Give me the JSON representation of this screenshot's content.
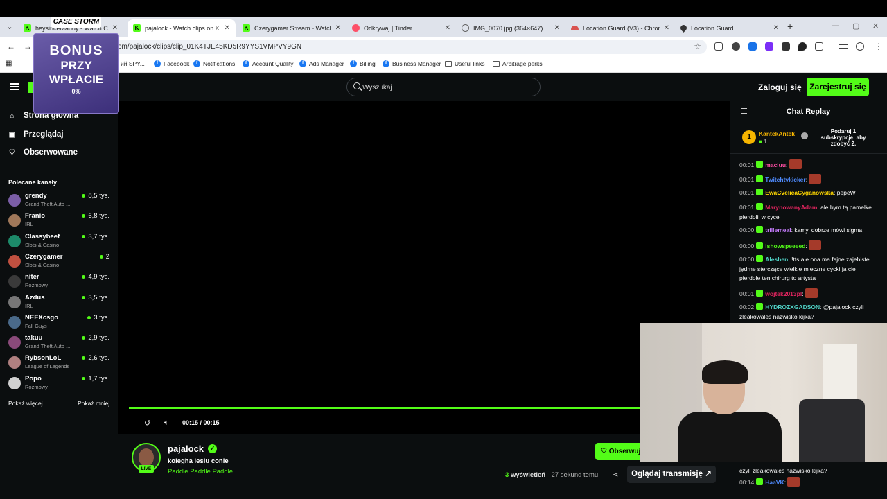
{
  "browser": {
    "tabs": [
      {
        "title": "heysinceMaddy - Watch Clips",
        "color": "#53fc18",
        "active": false
      },
      {
        "title": "pajalock - Watch clips on Kick",
        "color": "#53fc18",
        "active": true
      },
      {
        "title": "Czerygamer Stream - Watch Li",
        "color": "#53fc18",
        "active": false
      },
      {
        "title": "Odkrywaj | Tinder",
        "color": "#fd5068",
        "active": false
      },
      {
        "title": "IMG_0070.jpg (364×647)",
        "color": "#666666",
        "active": false
      },
      {
        "title": "Location Guard (V3) - Chrome",
        "color": "#d9534f",
        "active": false
      },
      {
        "title": "Location Guard",
        "color": "#333333",
        "active": false
      }
    ],
    "url": "om/pajalock/clips/clip_01K4TJE45KD5R9YYS1VMPVY9GN",
    "bookmarks": [
      {
        "label": "ий SPY...",
        "icon": "folder"
      },
      {
        "label": "Facebook",
        "icon": "facebook"
      },
      {
        "label": "Notifications",
        "icon": "facebook"
      },
      {
        "label": "Account Quality",
        "icon": "facebook"
      },
      {
        "label": "Ads Manager",
        "icon": "facebook"
      },
      {
        "label": "Billing",
        "icon": "facebook"
      },
      {
        "label": "Business Manager",
        "icon": "facebook"
      },
      {
        "label": "Useful links",
        "icon": "folder"
      },
      {
        "label": "Arbitrage perks",
        "icon": "folder"
      }
    ]
  },
  "header": {
    "search_placeholder": "Wyszukaj",
    "login": "Zaloguj się",
    "register": "Zarejestruj się",
    "accent": "#53fc18"
  },
  "sidebar": {
    "nav": [
      {
        "label": "Strona główna",
        "icon": "home-icon"
      },
      {
        "label": "Przeglądaj",
        "icon": "browse-icon"
      },
      {
        "label": "Obserwowane",
        "icon": "heart-icon"
      }
    ],
    "section_title": "Polecane kanały",
    "channels": [
      {
        "name": "grendy",
        "category": "Grand Theft Auto ...",
        "viewers": "8,5 tys.",
        "color": "#7b5ea7"
      },
      {
        "name": "Franio",
        "category": "IRL",
        "viewers": "6,8 tys.",
        "color": "#a0785a"
      },
      {
        "name": "Classybeef",
        "category": "Slots & Casino",
        "viewers": "3,7 tys.",
        "color": "#1d8a6a"
      },
      {
        "name": "Czerygamer",
        "category": "Slots & Casino",
        "viewers": "2",
        "color": "#c05040"
      },
      {
        "name": "niter",
        "category": "Rozmowy",
        "viewers": "4,9 tys.",
        "color": "#3a3a3a"
      },
      {
        "name": "Azdus",
        "category": "IRL",
        "viewers": "3,5 tys.",
        "color": "#777777"
      },
      {
        "name": "NEEXcsgo",
        "category": "Fall Guys",
        "viewers": "3 tys.",
        "color": "#4a6a8a"
      },
      {
        "name": "takuu",
        "category": "Grand Theft Auto ...",
        "viewers": "2,9 tys.",
        "color": "#8a4a7a"
      },
      {
        "name": "RybsonLoL",
        "category": "League of Legends",
        "viewers": "2,6 tys.",
        "color": "#b08080"
      },
      {
        "name": "Popo",
        "category": "Rozmowy",
        "viewers": "1,7 tys.",
        "color": "#d0d0d0"
      }
    ],
    "show_more": "Pokaż więcej",
    "show_less": "Pokaż mniej"
  },
  "player": {
    "time": "00:15 / 00:15",
    "progress": 1.0
  },
  "stream": {
    "channel": "pajalock",
    "title": "kolegha lesiu conie",
    "category": "Paddle Paddle Paddle",
    "live": "LIVE",
    "follow": "Obserwuj",
    "views_count": "3",
    "views_label": "wyświetleń",
    "ago": "· 27 sekund temu",
    "watch": "Oglądaj transmisję"
  },
  "chat": {
    "title": "Chat Replay",
    "gift_user": "KantekAntek",
    "gift_count": "1",
    "gift_text": "Podaruj 1 subskrypcję, aby zdobyć 2.",
    "messages": [
      {
        "ts": "00:01",
        "user": "maciuu",
        "color": "#ff4fa3",
        "text": ""
      },
      {
        "ts": "00:01",
        "user": "Twitchtvkicker",
        "color": "#4f8bff",
        "text": ""
      },
      {
        "ts": "00:01",
        "user": "EwaCvelicaCyganowska",
        "color": "#ffd700",
        "text": "pepeW"
      },
      {
        "ts": "00:01",
        "user": "MarynowanyAdam",
        "color": "#e0245e",
        "text": "ale bym tą pamelke pierdolil w cyce"
      },
      {
        "ts": "00:00",
        "user": "trillemeal",
        "color": "#c77dff",
        "text": "kamyl dobrze mówi sigma"
      },
      {
        "ts": "00:00",
        "user": "ishowspeeeed",
        "color": "#53fc18",
        "text": ""
      },
      {
        "ts": "00:00",
        "user": "Aleshen",
        "color": "#4fd1c5",
        "text": "!tts ale ona ma fajne zajebiste jędrne sterczące wielkie mleczne cycki ja cie pierdole ten chirurg to artysta"
      },
      {
        "ts": "00:01",
        "user": "wojtek2013pl",
        "color": "#e0245e",
        "text": ""
      },
      {
        "ts": "00:02",
        "user": "HYDROZXGADSON",
        "color": "#4fd1c5",
        "text": "@pajalock czyli zleakowales nazwisko kijka?"
      },
      {
        "ts": "00:14",
        "user": "HaaVK",
        "color": "#4f8bff",
        "text": ""
      }
    ],
    "repeat_text": "czyli zleakowales nazwisko kijka?"
  },
  "overlay": {
    "logo": "CASE STORM",
    "promo_line1": "BONUS",
    "promo_line2": "PRZY",
    "promo_line3": "WPŁACIE",
    "promo_line4": "0%"
  }
}
